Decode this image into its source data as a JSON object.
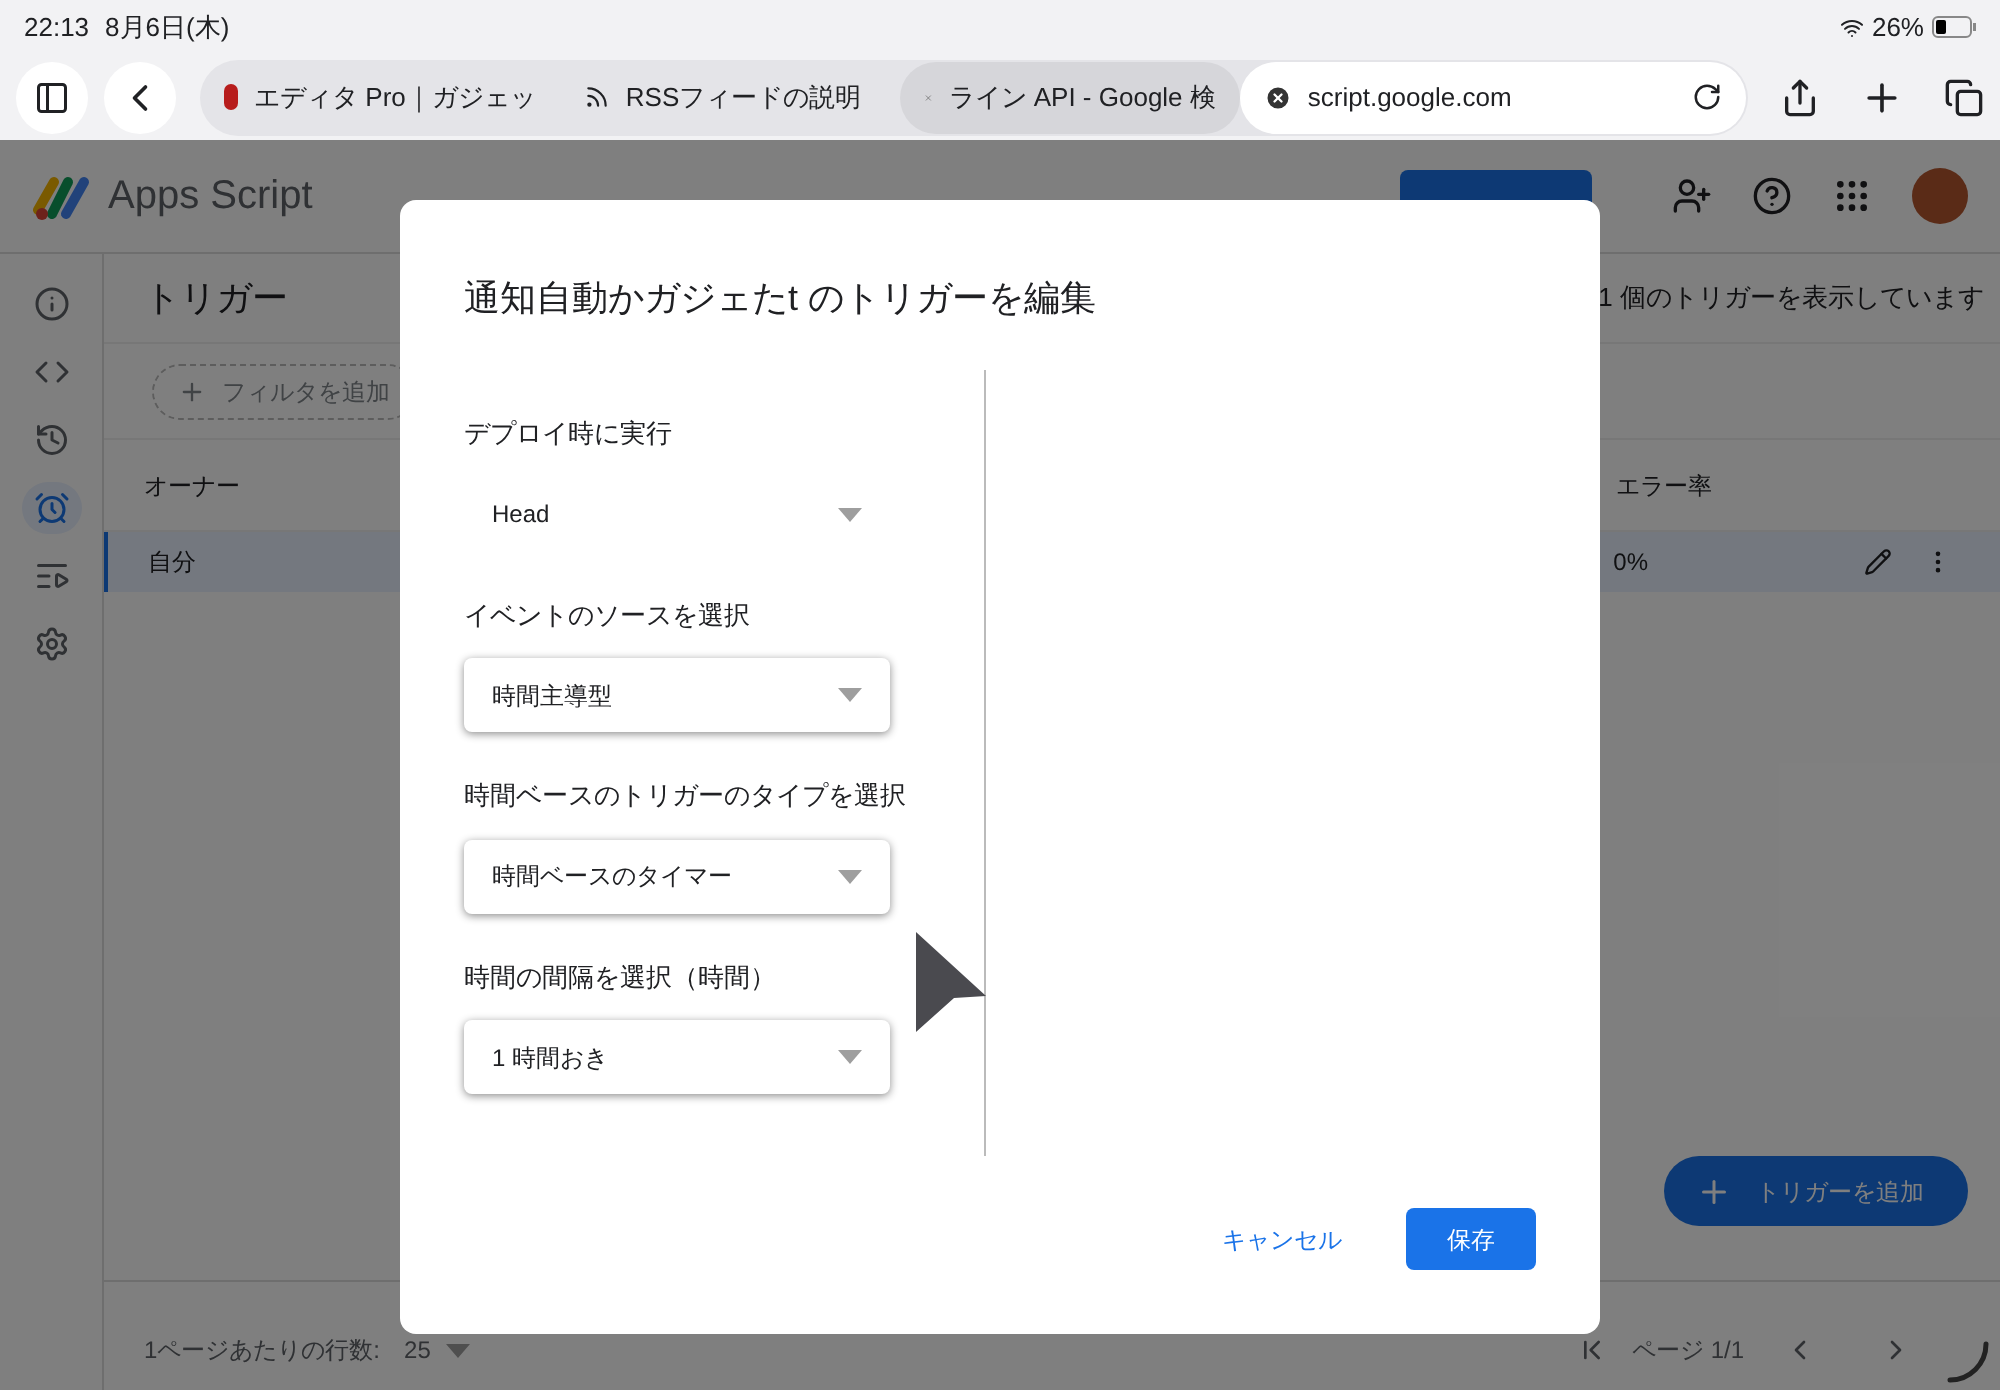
{
  "status_bar": {
    "time": "22:13",
    "date": "8月6日(木)",
    "battery": "26%"
  },
  "browser": {
    "tabs": [
      {
        "title": "エディタ Pro｜ガジェッ",
        "selected": false
      },
      {
        "title": "RSSフィードの説明",
        "selected": false
      },
      {
        "title": "ライン API - Google 検",
        "selected": false
      },
      {
        "title": "script.google.com",
        "selected": true
      }
    ]
  },
  "app": {
    "product": "Apps Script",
    "rail": [
      {
        "kind": "info",
        "selected": false
      },
      {
        "kind": "code",
        "selected": false
      },
      {
        "kind": "history",
        "selected": false
      },
      {
        "kind": "triggers",
        "selected": true
      },
      {
        "kind": "executions",
        "selected": false
      },
      {
        "kind": "settings",
        "selected": false
      }
    ],
    "page_title": "トリガー",
    "count": "1 個のトリガーを表示しています",
    "filter": "フィルタを追加",
    "columns": [
      "オーナー",
      "エラー率"
    ],
    "rows": [
      {
        "owner": "自分",
        "error_rate": "0%",
        "selected": true
      }
    ],
    "fab": "トリガーを追加",
    "footer": {
      "rows_per_page_label": "1ページあたりの行数:",
      "rows_per_page": "25",
      "page": "ページ 1/1"
    }
  },
  "dialog": {
    "title": "通知自動かガジェたt のトリガーを編集",
    "fields": [
      {
        "label": "デプロイ時に実行",
        "value": "Head",
        "kind": "plain"
      },
      {
        "label": "イベントのソースを選択",
        "value": "時間主導型",
        "kind": "outlined"
      },
      {
        "label": "時間ベースのトリガーのタイプを選択",
        "value": "時間ベースのタイマー",
        "kind": "outlined"
      },
      {
        "label": "時間の間隔を選択（時間）",
        "value": "1 時間おき",
        "kind": "outlined"
      }
    ],
    "cancel": "キャンセル",
    "save": "保存"
  }
}
